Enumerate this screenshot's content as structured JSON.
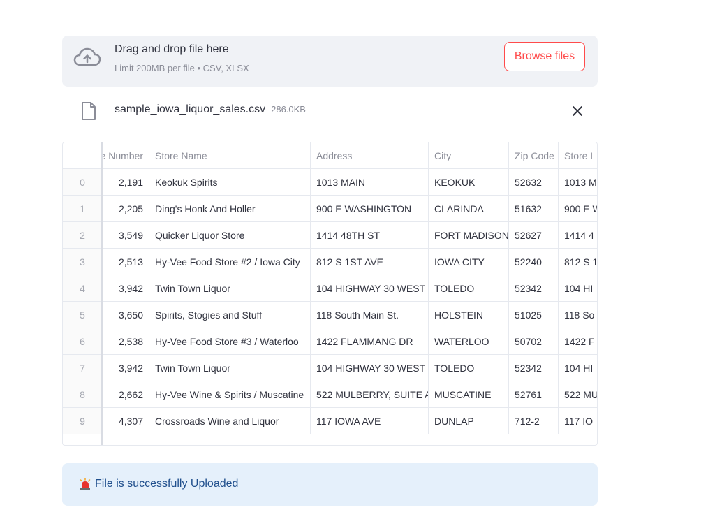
{
  "uploader": {
    "title": "Drag and drop file here",
    "hint": "Limit 200MB per file • CSV, XLSX",
    "browse_label": "Browse files"
  },
  "file": {
    "name": "sample_iowa_liquor_sales.csv",
    "size": "286.0KB"
  },
  "table": {
    "headers": [
      "e Number",
      "Store Name",
      "Address",
      "City",
      "Zip Code",
      "Store L"
    ],
    "rows": [
      {
        "index": "0",
        "number": "2,191",
        "name": "Keokuk Spirits",
        "address": "1013 MAIN",
        "city": "KEOKUK",
        "zip": "52632",
        "loc": "1013 M"
      },
      {
        "index": "1",
        "number": "2,205",
        "name": "Ding's Honk And Holler",
        "address": "900 E WASHINGTON",
        "city": "CLARINDA",
        "zip": "51632",
        "loc": "900 E W"
      },
      {
        "index": "2",
        "number": "3,549",
        "name": "Quicker Liquor Store",
        "address": "1414 48TH ST",
        "city": "FORT MADISON",
        "zip": "52627",
        "loc": "1414 4"
      },
      {
        "index": "3",
        "number": "2,513",
        "name": "Hy-Vee Food Store #2 / Iowa City",
        "address": "812  S 1ST AVE",
        "city": "IOWA CITY",
        "zip": "52240",
        "loc": "812 S 1"
      },
      {
        "index": "4",
        "number": "3,942",
        "name": "Twin Town Liquor",
        "address": "104 HIGHWAY 30 WEST",
        "city": "TOLEDO",
        "zip": "52342",
        "loc": "104 HI"
      },
      {
        "index": "5",
        "number": "3,650",
        "name": "Spirits, Stogies and Stuff",
        "address": "118 South Main St.",
        "city": "HOLSTEIN",
        "zip": "51025",
        "loc": "118 So"
      },
      {
        "index": "6",
        "number": "2,538",
        "name": "Hy-Vee Food Store #3 / Waterloo",
        "address": "1422 FLAMMANG DR",
        "city": "WATERLOO",
        "zip": "50702",
        "loc": "1422 F"
      },
      {
        "index": "7",
        "number": "3,942",
        "name": "Twin Town Liquor",
        "address": "104 HIGHWAY 30 WEST",
        "city": "TOLEDO",
        "zip": "52342",
        "loc": "104 HI"
      },
      {
        "index": "8",
        "number": "2,662",
        "name": "Hy-Vee Wine & Spirits / Muscatine",
        "address": "522 MULBERRY, SUITE A",
        "city": "MUSCATINE",
        "zip": "52761",
        "loc": "522 MU"
      },
      {
        "index": "9",
        "number": "4,307",
        "name": "Crossroads Wine and Liquor",
        "address": "117 IOWA AVE",
        "city": "DUNLAP",
        "zip": "712-2",
        "loc": "117 IO"
      }
    ]
  },
  "status": {
    "message": "File is successfully Uploaded"
  },
  "colors": {
    "accent": "#ff4b4b",
    "success_bg": "#e5f0fb",
    "success_text": "#1f4e8c"
  }
}
